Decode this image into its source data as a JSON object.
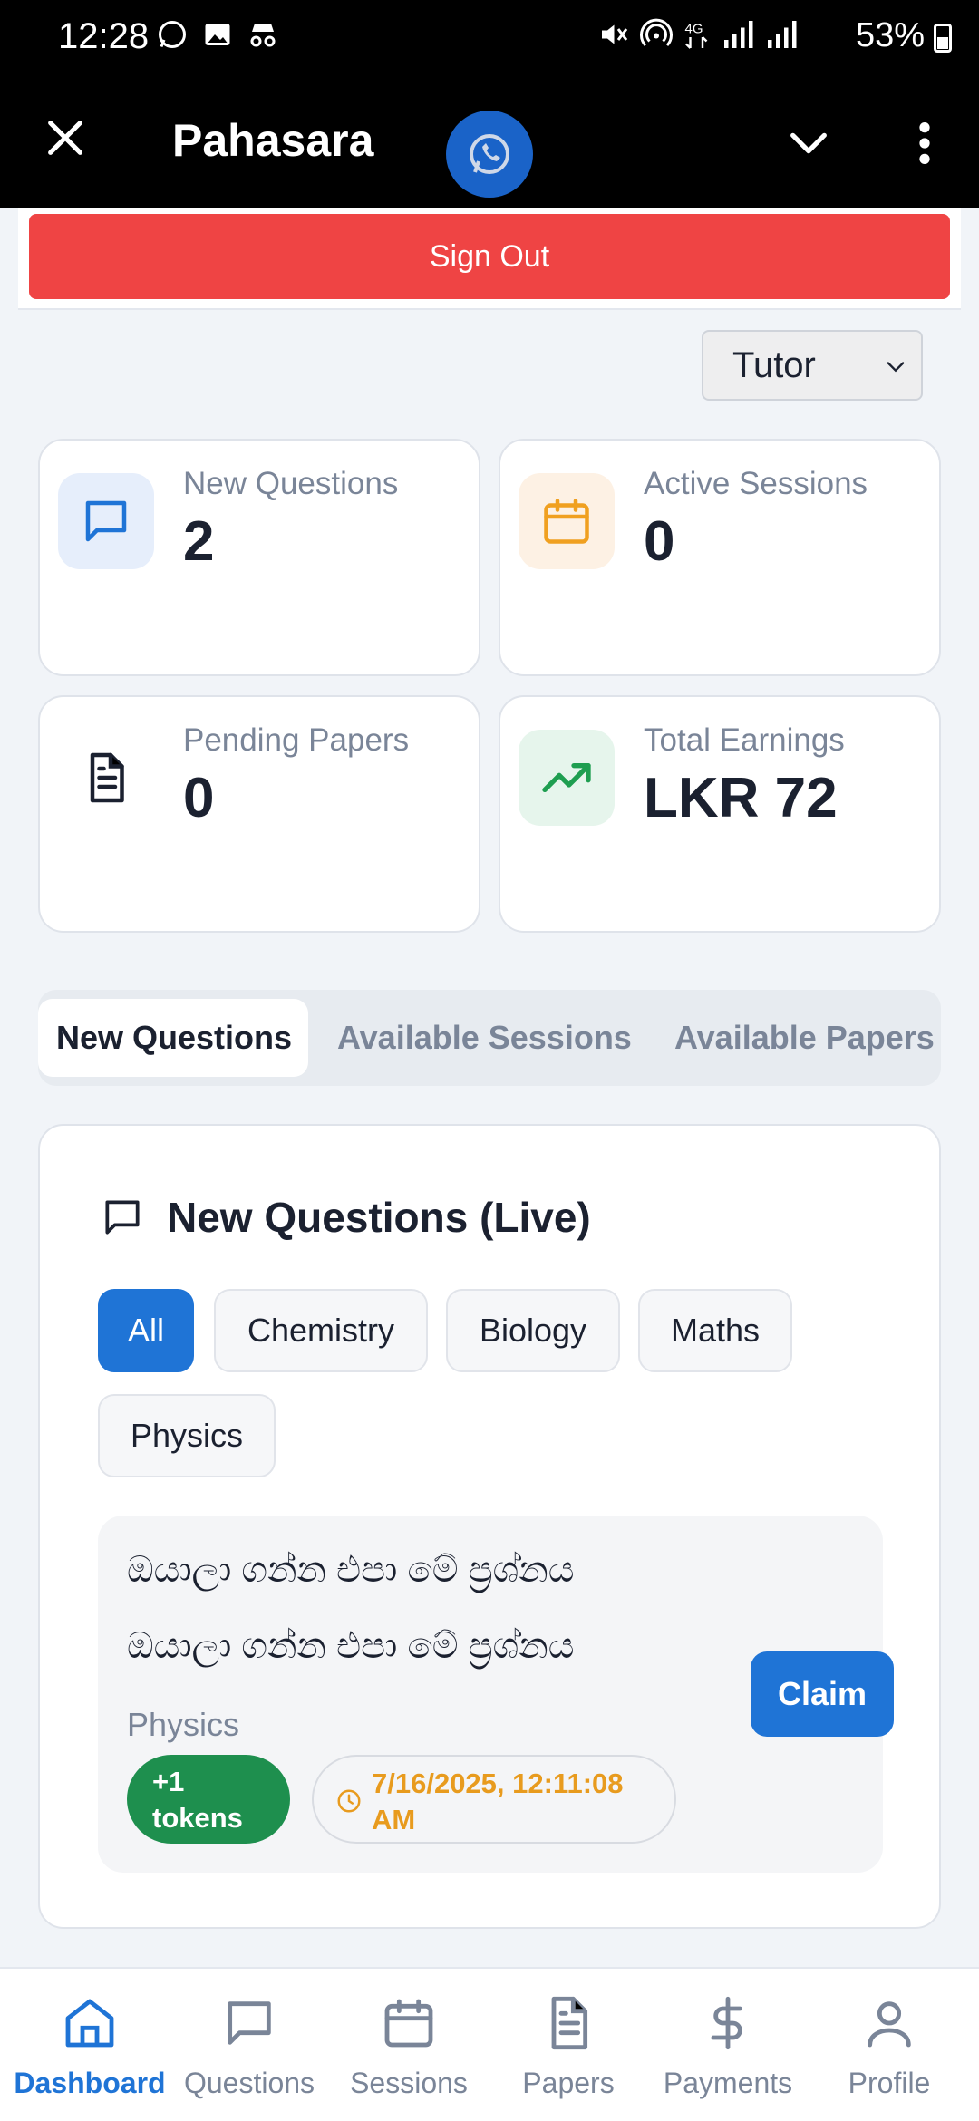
{
  "status_bar": {
    "time": "12:28",
    "battery": "53%"
  },
  "app_bar": {
    "title": "Pahasara"
  },
  "sign_out_label": "Sign Out",
  "role_select": {
    "value": "Tutor"
  },
  "stats": [
    {
      "label": "New Questions",
      "value": "2",
      "icon": "message-square-icon",
      "color": "#1f74d6"
    },
    {
      "label": "Active Sessions",
      "value": "0",
      "icon": "calendar-icon",
      "color": "#f0a020"
    },
    {
      "label": "Pending Papers",
      "value": "0",
      "icon": "file-text-icon",
      "color": "#1b2130"
    },
    {
      "label": "Total Earnings",
      "value": "LKR 72",
      "icon": "trending-up-icon",
      "color": "#1e9e50"
    }
  ],
  "tabs": [
    "New Questions",
    "Available Sessions",
    "Available Papers"
  ],
  "panel": {
    "title": "New Questions (Live)",
    "filters": [
      "All",
      "Chemistry",
      "Biology",
      "Maths",
      "Physics"
    ],
    "question": {
      "line1": "ඔයාලා ගන්න එපා මේ ප්‍රශ්නය",
      "line2": "ඔයාලා ගන්න එපා මේ ප්‍රශ්නය",
      "subject": "Physics",
      "tokens_line1": "+1",
      "tokens_line2": "tokens",
      "time_line1": "7/16/2025, 12:11:08",
      "time_line2": "AM",
      "claim_label": "Claim"
    }
  },
  "bottom_nav": [
    "Dashboard",
    "Questions",
    "Sessions",
    "Papers",
    "Payments",
    "Profile"
  ],
  "accent_color": "#1f74d6"
}
